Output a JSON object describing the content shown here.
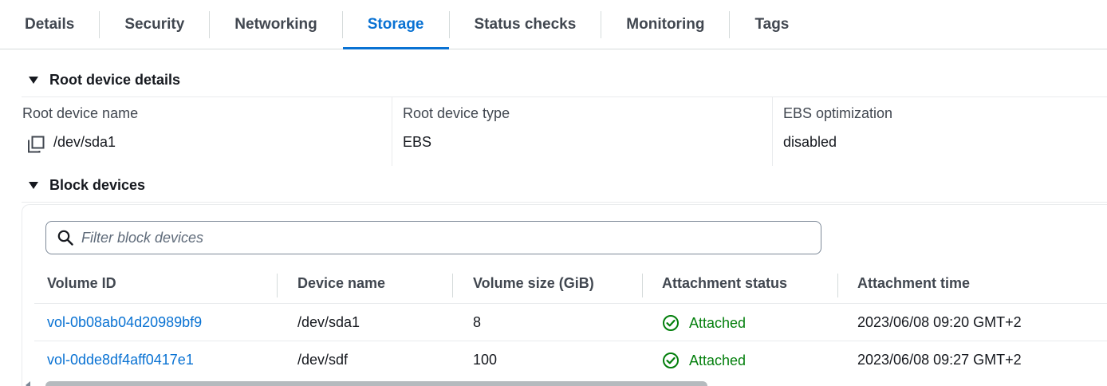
{
  "tabs": [
    {
      "label": "Details",
      "active": false
    },
    {
      "label": "Security",
      "active": false
    },
    {
      "label": "Networking",
      "active": false
    },
    {
      "label": "Storage",
      "active": true
    },
    {
      "label": "Status checks",
      "active": false
    },
    {
      "label": "Monitoring",
      "active": false
    },
    {
      "label": "Tags",
      "active": false
    }
  ],
  "root_device": {
    "section_title": "Root device details",
    "name_label": "Root device name",
    "name_value": "/dev/sda1",
    "type_label": "Root device type",
    "type_value": "EBS",
    "ebs_label": "EBS optimization",
    "ebs_value": "disabled"
  },
  "block_devices": {
    "section_title": "Block devices",
    "filter_placeholder": "Filter block devices",
    "columns": [
      "Volume ID",
      "Device name",
      "Volume size (GiB)",
      "Attachment status",
      "Attachment time"
    ],
    "rows": [
      {
        "volume_id": "vol-0b08ab04d20989bf9",
        "device": "/dev/sda1",
        "size": "8",
        "status": "Attached",
        "time": "2023/06/08 09:20 GMT+2"
      },
      {
        "volume_id": "vol-0dde8df4aff0417e1",
        "device": "/dev/sdf",
        "size": "100",
        "status": "Attached",
        "time": "2023/06/08 09:27 GMT+2"
      }
    ]
  },
  "colors": {
    "accent": "#0972d3",
    "success": "#037f0c",
    "text": "#16191f",
    "muted": "#414750"
  }
}
